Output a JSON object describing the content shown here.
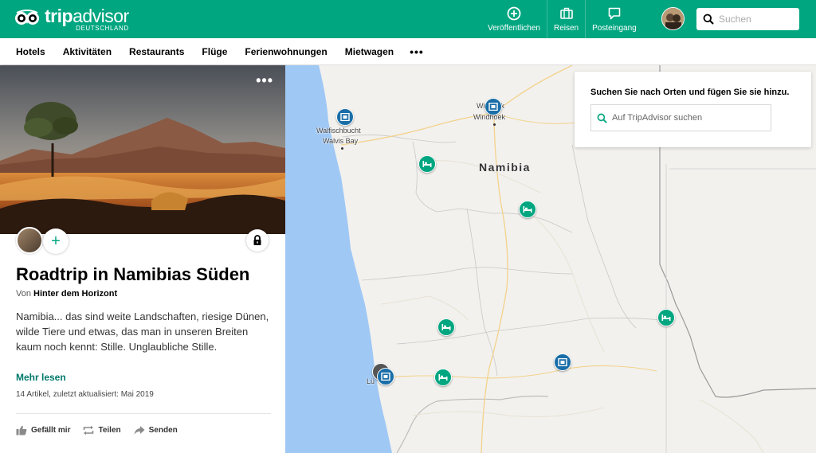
{
  "header": {
    "brand_trip": "trip",
    "brand_advisor": "advisor",
    "brand_sub": "DEUTSCHLAND",
    "actions": [
      {
        "label": "Veröffentlichen",
        "icon": "plus-circle-icon"
      },
      {
        "label": "Reisen",
        "icon": "suitcase-icon"
      },
      {
        "label": "Posteingang",
        "icon": "message-icon"
      }
    ],
    "search_placeholder": "Suchen"
  },
  "subnav": {
    "items": [
      "Hotels",
      "Aktivitäten",
      "Restaurants",
      "Flüge",
      "Ferienwohnungen",
      "Mietwagen"
    ],
    "more": "•••"
  },
  "trip": {
    "more": "•••",
    "add": "+",
    "title": "Roadtrip in Namibias Süden",
    "byline_prefix": "Von",
    "author": "Hinter dem Horizont",
    "description": "Namibia... das sind weite Landschaften, riesige Dünen, wilde Tiere und etwas, das man in unseren Breiten kaum noch kennt: Stille. Unglaubliche Stille.",
    "read_more": "Mehr lesen",
    "meta": "14 Artikel, zuletzt aktualisiert: Mai 2019",
    "actions": {
      "like": "Gefällt mir",
      "share": "Teilen",
      "send": "Senden"
    }
  },
  "map": {
    "country": "Namibia",
    "labels": {
      "walvis_de": "Walfischbucht",
      "walvis_en": "Walvis Bay",
      "windhoek_a": "Windhuk",
      "windhoek_b": "Windhoek",
      "luderitz": "Lü"
    },
    "search": {
      "title": "Suchen Sie nach Orten und fügen Sie sie hinzu.",
      "placeholder": "Auf TripAdvisor suchen"
    }
  },
  "colors": {
    "brand_green": "#00a680",
    "attraction_blue": "#1a6ea8",
    "ocean": "#9fc8f5",
    "link_green": "#00796b"
  }
}
